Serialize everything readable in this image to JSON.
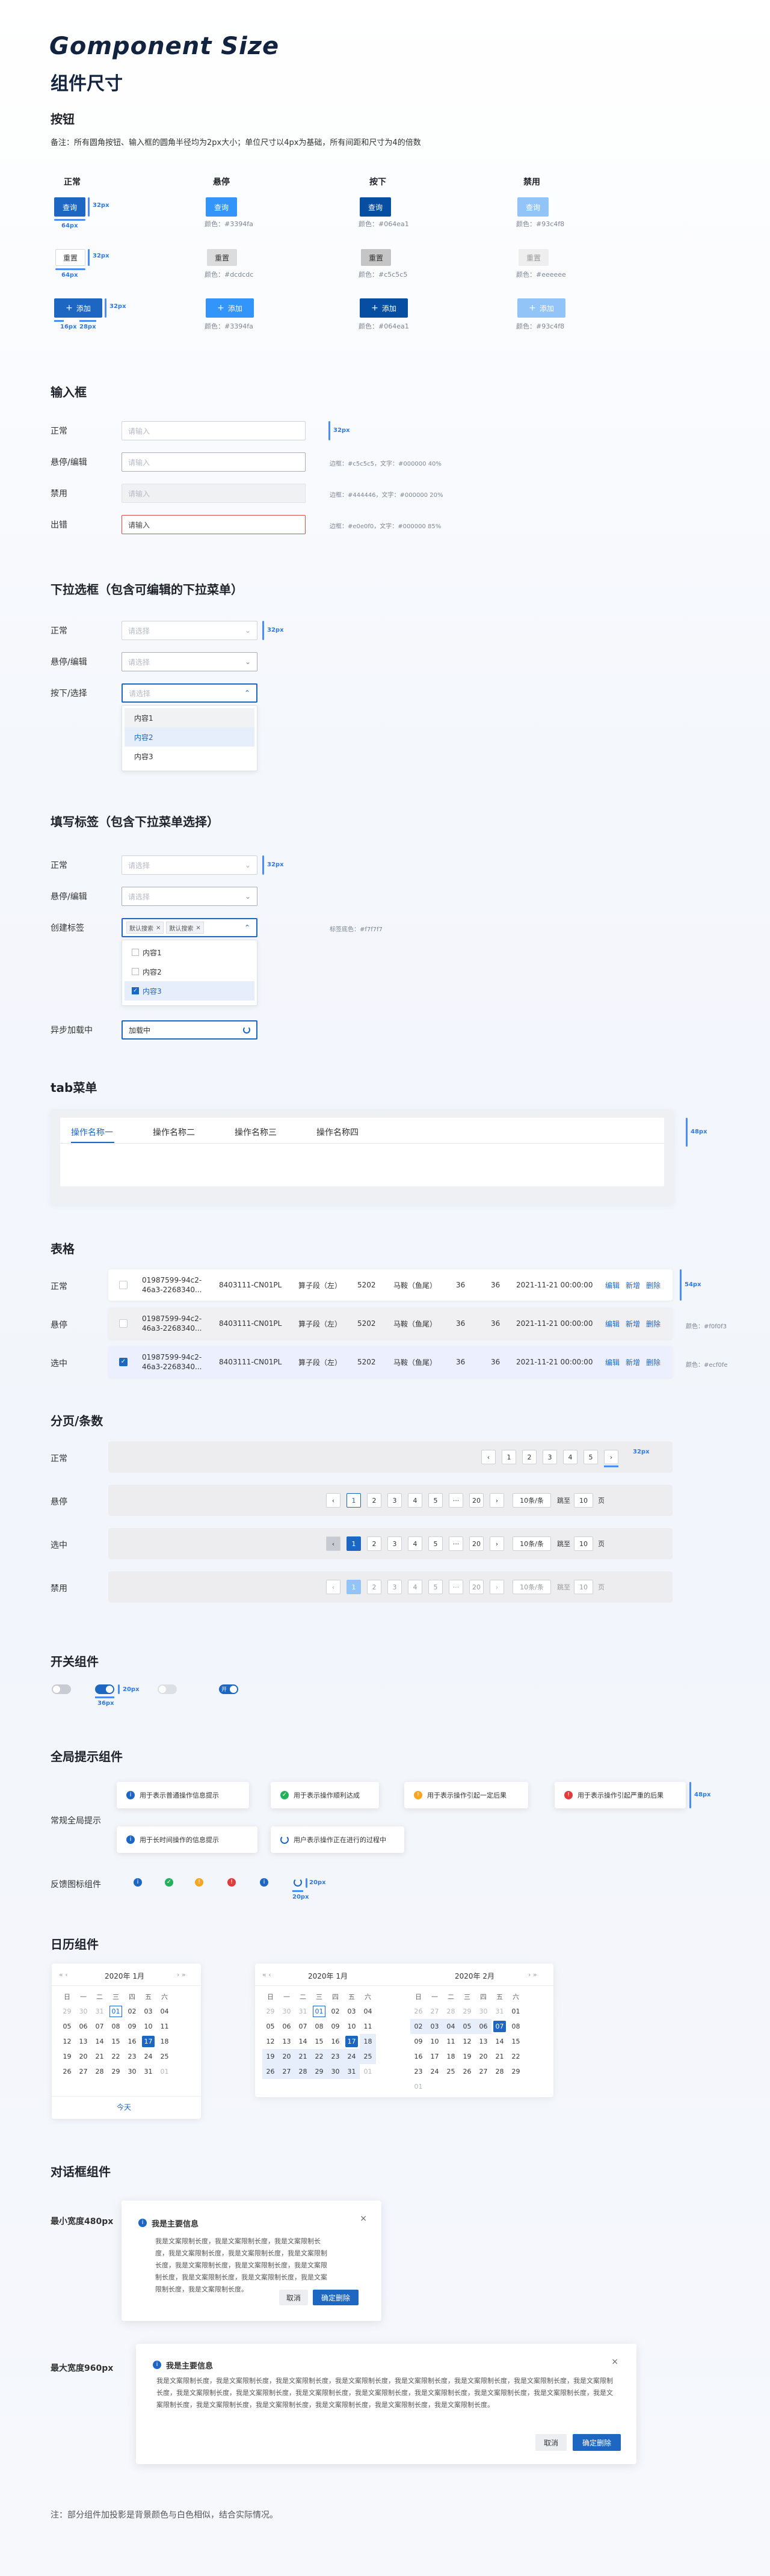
{
  "title_en": "Gomponent Size",
  "title_cn": "组件尺寸",
  "btn": {
    "section": "按钮",
    "note": "备注：所有圆角按钮、输入框的圆角半径均为2px大小；单位尺寸以4px为基础，所有间距和尺寸为4的倍数",
    "states": [
      "正常",
      "悬停",
      "按下",
      "禁用"
    ],
    "query": "查询",
    "reset": "重置",
    "add": "添加",
    "color_labels_primary": [
      "颜色：#3394fa",
      "颜色：#064ea1",
      "颜色：#93c4f8"
    ],
    "color_labels_default": [
      "颜色：#dcdcdc",
      "颜色：#c5c5c5",
      "颜色：#eeeeee"
    ],
    "color_labels_add": [
      "颜色：#3394fa",
      "颜色：#064ea1",
      "颜色：#93c4f8"
    ],
    "m_32px": "32px",
    "m_64px": "64px",
    "m_16px": "16px",
    "m_28px": "28px"
  },
  "input": {
    "section": "输入框",
    "labels": [
      "正常",
      "悬停/编辑",
      "禁用",
      "出错"
    ],
    "placeholder": "请输入",
    "notes": [
      "边框：#c5c5c5，文字：#000000 40%",
      "边框：#444446，文字：#000000 20%",
      "边框：#e0e0f0，文字：#000000 85%"
    ],
    "m_32px": "32px"
  },
  "select": {
    "section": "下拉选框（包含可编辑的下拉菜单）",
    "labels": [
      "正常",
      "悬停/编辑",
      "按下/选择"
    ],
    "placeholder": "请选择",
    "options": [
      "内容1",
      "内容2",
      "内容3"
    ],
    "m_32px": "32px"
  },
  "tagsel": {
    "section": "填写标签（包含下拉菜单选择）",
    "labels": [
      "正常",
      "悬停/编辑",
      "创建标签",
      "异步加载中"
    ],
    "placeholder": "请选择",
    "tags": [
      "默认搜索",
      "默认搜索"
    ],
    "options": [
      "内容1",
      "内容2",
      "内容3"
    ],
    "tag_note": "标签底色：#f7f7f7",
    "loading": "加载中",
    "m_32px": "32px"
  },
  "tabs": {
    "section": "tab菜单",
    "items": [
      "操作名称一",
      "操作名称二",
      "操作名称三",
      "操作名称四"
    ],
    "m_48px": "48px"
  },
  "table": {
    "section": "表格",
    "labels": [
      "正常",
      "悬停",
      "选中"
    ],
    "row": {
      "id": "01987599-94c2-46a3-2268340...",
      "code": "8403111-CN01PL",
      "name": "算子段（左）",
      "num": "5202",
      "type": "马鞍（鱼尾）",
      "a": "36",
      "b": "36",
      "date": "2021-11-21 00:00:00",
      "ops": [
        "编辑",
        "新增",
        "删除"
      ]
    },
    "m_54px": "54px",
    "hover_note": "颜色：#f0f0f3",
    "select_note": "颜色：#ecf0fe"
  },
  "pagination": {
    "section": "分页/条数",
    "labels": [
      "正常",
      "悬停",
      "选中",
      "禁用"
    ],
    "pages": [
      "1",
      "2",
      "3",
      "4",
      "5",
      "···",
      "20"
    ],
    "per": "10条/条",
    "jump": "跳至",
    "jump_val": "10",
    "page_unit": "页",
    "m_32px": "32px"
  },
  "switch": {
    "section": "开关组件",
    "on_text": "开",
    "m_20px": "20px",
    "m_36px": "36px"
  },
  "toast": {
    "section": "全局提示组件",
    "labels": [
      "常规全局提示",
      "反馈图标组件"
    ],
    "msgs": [
      "用于表示普通操作信息提示",
      "用于表示操作顺利达成",
      "用于表示操作引起一定后果",
      "用于表示操作引起严重的后果"
    ],
    "msgs2": [
      "用于长时间操作的信息提示",
      "用户表示操作正在进行的过程中"
    ],
    "m_48px": "48px",
    "m_20px": "20px"
  },
  "calendar": {
    "section": "日历组件",
    "weekdays": [
      "日",
      "一",
      "二",
      "三",
      "四",
      "五",
      "六"
    ],
    "title1": "2020年 1月",
    "title2a": "2020年 1月",
    "title2b": "2020年 2月",
    "today": "今天",
    "m1": [
      [
        "29",
        "o"
      ],
      [
        "30",
        "o"
      ],
      [
        "31",
        "o"
      ],
      [
        "01",
        "sel"
      ],
      [
        "02",
        ""
      ],
      [
        "03",
        ""
      ],
      [
        "04",
        ""
      ],
      [
        "05",
        ""
      ],
      [
        "06",
        ""
      ],
      [
        "07",
        ""
      ],
      [
        "08",
        ""
      ],
      [
        "09",
        ""
      ],
      [
        "10",
        ""
      ],
      [
        "11",
        ""
      ],
      [
        "12",
        ""
      ],
      [
        "13",
        ""
      ],
      [
        "14",
        ""
      ],
      [
        "15",
        ""
      ],
      [
        "16",
        ""
      ],
      [
        "17",
        "act"
      ],
      [
        "18",
        ""
      ],
      [
        "19",
        ""
      ],
      [
        "20",
        ""
      ],
      [
        "21",
        ""
      ],
      [
        "22",
        ""
      ],
      [
        "23",
        ""
      ],
      [
        "24",
        ""
      ],
      [
        "25",
        ""
      ],
      [
        "26",
        ""
      ],
      [
        "27",
        ""
      ],
      [
        "28",
        ""
      ],
      [
        "29",
        ""
      ],
      [
        "30",
        ""
      ],
      [
        "31",
        ""
      ],
      [
        "01",
        "o"
      ]
    ],
    "m2": [
      [
        "29",
        "o"
      ],
      [
        "30",
        "o"
      ],
      [
        "31",
        "o"
      ],
      [
        "01",
        "sel"
      ],
      [
        "02",
        ""
      ],
      [
        "03",
        ""
      ],
      [
        "04",
        ""
      ],
      [
        "05",
        ""
      ],
      [
        "06",
        ""
      ],
      [
        "07",
        ""
      ],
      [
        "08",
        ""
      ],
      [
        "09",
        ""
      ],
      [
        "10",
        ""
      ],
      [
        "11",
        ""
      ],
      [
        "12",
        ""
      ],
      [
        "13",
        ""
      ],
      [
        "14",
        ""
      ],
      [
        "15",
        ""
      ],
      [
        "16",
        ""
      ],
      [
        "17",
        "act"
      ],
      [
        "18",
        "r"
      ],
      [
        "19",
        "r"
      ],
      [
        "20",
        "r"
      ],
      [
        "21",
        "r"
      ],
      [
        "22",
        "r"
      ],
      [
        "23",
        "r"
      ],
      [
        "24",
        "r"
      ],
      [
        "25",
        "r"
      ],
      [
        "26",
        "r"
      ],
      [
        "27",
        "r"
      ],
      [
        "28",
        "r"
      ],
      [
        "29",
        "r"
      ],
      [
        "30",
        "r"
      ],
      [
        "31",
        "r"
      ],
      [
        "01",
        "o"
      ]
    ],
    "m3": [
      [
        "26",
        "o"
      ],
      [
        "27",
        "o"
      ],
      [
        "28",
        "o"
      ],
      [
        "29",
        "o"
      ],
      [
        "30",
        "o"
      ],
      [
        "31",
        "o"
      ],
      [
        "01",
        ""
      ],
      [
        "02",
        "r"
      ],
      [
        "03",
        "r"
      ],
      [
        "04",
        "r"
      ],
      [
        "05",
        "r"
      ],
      [
        "06",
        "r"
      ],
      [
        "07",
        "act"
      ],
      [
        "08",
        ""
      ],
      [
        "09",
        ""
      ],
      [
        "10",
        ""
      ],
      [
        "11",
        ""
      ],
      [
        "12",
        ""
      ],
      [
        "13",
        ""
      ],
      [
        "14",
        ""
      ],
      [
        "15",
        ""
      ],
      [
        "16",
        ""
      ],
      [
        "17",
        ""
      ],
      [
        "18",
        ""
      ],
      [
        "19",
        ""
      ],
      [
        "20",
        ""
      ],
      [
        "21",
        ""
      ],
      [
        "22",
        ""
      ],
      [
        "23",
        ""
      ],
      [
        "24",
        ""
      ],
      [
        "25",
        ""
      ],
      [
        "26",
        ""
      ],
      [
        "27",
        ""
      ],
      [
        "28",
        ""
      ],
      [
        "29",
        ""
      ],
      [
        "01",
        "o"
      ]
    ]
  },
  "dialog": {
    "section": "对话框组件",
    "labels": [
      "最小宽度480px",
      "最大宽度960px"
    ],
    "title": "我是主要信息",
    "body": "我是文案限制长度，我是文案限制长度，我是文案限制长度，我是文案限制长度，我是文案限制长度，我是文案限制长度，我是文案限制长度，我是文案限制长度，我是文案限制长度，我是文案限制长度，我是文案限制长度，我是文案限制长度，我是文案限制长度。",
    "body_big": "我是文案限制长度，我是文案限制长度，我是文案限制长度，我是文案限制长度，我是文案限制长度，我是文案限制长度，我是文案限制长度，我是文案限制长度，我是文案限制长度，我是文案限制长度，我是文案限制长度，我是文案限制长度，我是文案限制长度，我是文案限制长度，我是文案限制长度，我是文案限制长度，我是文案限制长度，我是文案限制长度，我是文案限制长度，我是文案限制长度，我是文案限制长度。",
    "cancel": "取消",
    "ok": "确定删除"
  },
  "footnote": "注：部分组件加投影是背景颜色与白色相似，结合实际情况。",
  "colors": {
    "primary": "#1d67c2",
    "hover": "#3394fa",
    "press": "#064ea1",
    "disabled": "#93c4f8"
  }
}
